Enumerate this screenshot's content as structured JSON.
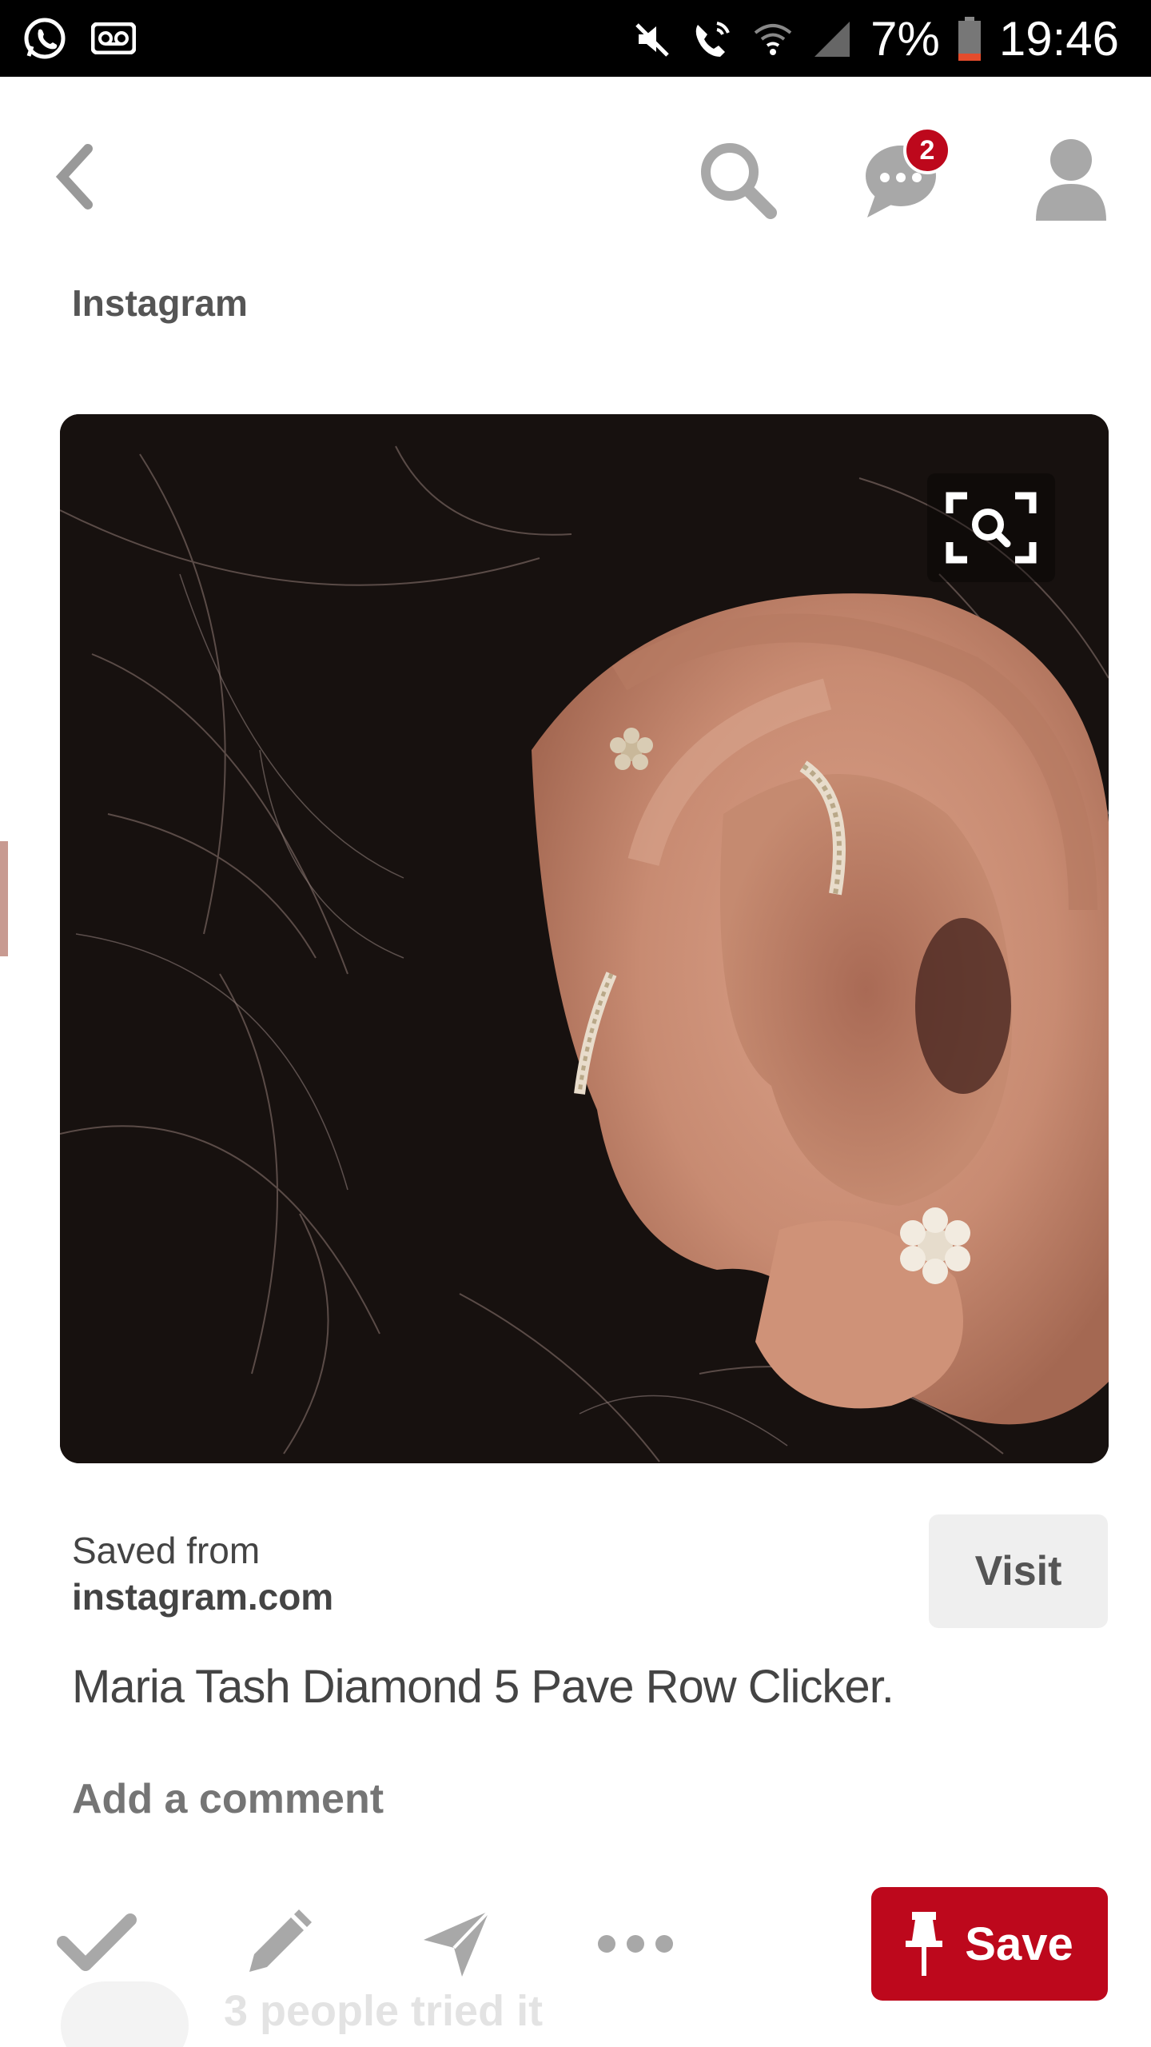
{
  "status_bar": {
    "battery": "7%",
    "time": "19:46",
    "left_icons": [
      "whatsapp-icon",
      "voicemail-icon"
    ],
    "right_icons": [
      "mute-icon",
      "wifi-calling-icon",
      "wifi-icon",
      "signal-icon",
      "battery-icon"
    ]
  },
  "header": {
    "icons": [
      "back-arrow-icon",
      "search-icon",
      "messages-icon",
      "profile-icon"
    ],
    "message_badge": "2"
  },
  "pin": {
    "source_name": "Instagram",
    "saved_from_label": "Saved from",
    "saved_from_domain": "instagram.com",
    "visit_label": "Visit",
    "description": "Maria Tash Diamond 5 Pave Row Clicker.",
    "comment_placeholder": "Add a comment",
    "tried_text": "3 people tried it"
  },
  "actions": {
    "icons": [
      "checkmark-icon",
      "pencil-icon",
      "send-icon",
      "more-icon"
    ],
    "save_label": "Save"
  },
  "colors": {
    "brand_red": "#bd081c",
    "status_bar_bg": "#000000",
    "icon_gray": "#a8a8a8",
    "text_gray": "#444444"
  }
}
